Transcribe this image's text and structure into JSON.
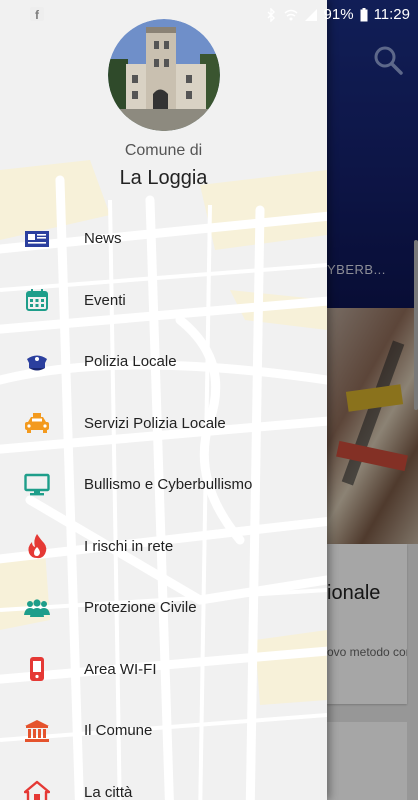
{
  "status_bar": {
    "battery": "91%",
    "time": "11:29",
    "fb_icon": "facebook-icon"
  },
  "background": {
    "ticker": "YBERB...",
    "card_title": "ionale",
    "card_text": "ovo metodo consentire zioni, in par..."
  },
  "drawer": {
    "header": {
      "label": "Comune di",
      "name": "La Loggia"
    },
    "items": [
      {
        "label": "News",
        "icon": "newspaper-icon",
        "color": "#2b3f9e"
      },
      {
        "label": "Eventi",
        "icon": "calendar-icon",
        "color": "#1e9e8a"
      },
      {
        "label": "Polizia Locale",
        "icon": "police-cap-icon",
        "color": "#2b3f9e"
      },
      {
        "label": "Servizi Polizia Locale",
        "icon": "taxi-icon",
        "color": "#f39a1e"
      },
      {
        "label": "Bullismo e Cyberbullismo",
        "icon": "monitor-icon",
        "color": "#1e9e8a"
      },
      {
        "label": "I rischi in rete",
        "icon": "fire-icon",
        "color": "#e53935"
      },
      {
        "label": "Protezione Civile",
        "icon": "people-icon",
        "color": "#1e9e8a"
      },
      {
        "label": "Area WI-FI",
        "icon": "mobile-phone-icon",
        "color": "#e53935"
      },
      {
        "label": "Il Comune",
        "icon": "town-hall-icon",
        "color": "#e5532d"
      },
      {
        "label": "La città",
        "icon": "home-icon",
        "color": "#e53935"
      }
    ]
  }
}
